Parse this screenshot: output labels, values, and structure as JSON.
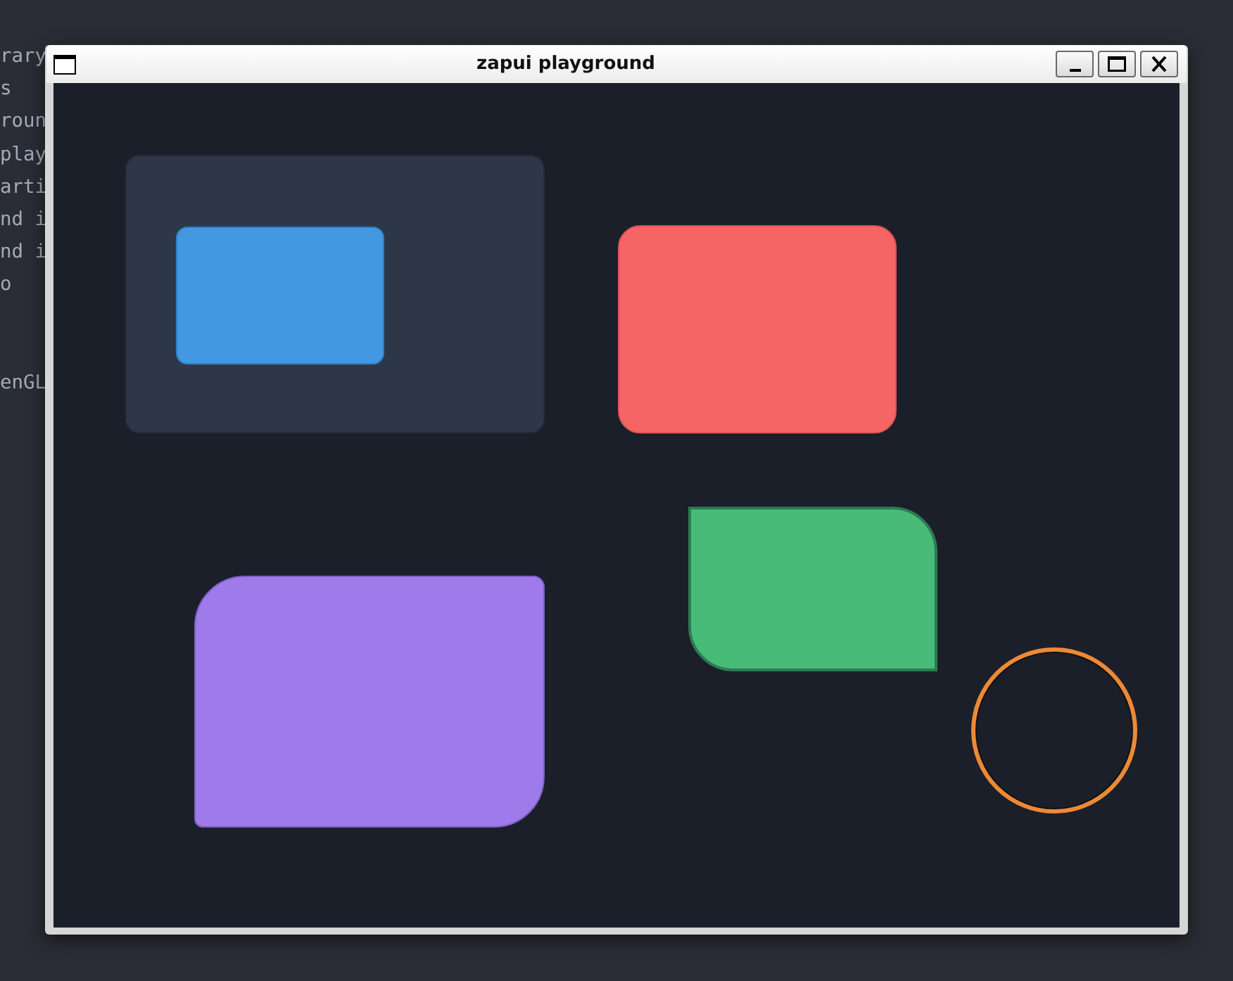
{
  "terminal": {
    "paragraphs": [
      {
        "lines": [
          "rary",
          "s",
          "roun",
          "play",
          "arti",
          "nd i",
          "nd i",
          "o"
        ]
      },
      {
        "lines": [
          "enGL"
        ]
      }
    ]
  },
  "window": {
    "title": "zapui playground"
  },
  "canvas": {
    "shapes": [
      {
        "kind": "panel",
        "color": "#2d3748",
        "children": [
          {
            "kind": "rect",
            "color": "#4299e1"
          }
        ]
      },
      {
        "kind": "rect",
        "color": "#f56565"
      },
      {
        "kind": "rect",
        "color": "#48bb78"
      },
      {
        "kind": "rect",
        "color": "#9f7aea"
      },
      {
        "kind": "ring",
        "color": "#ed8936"
      }
    ]
  }
}
